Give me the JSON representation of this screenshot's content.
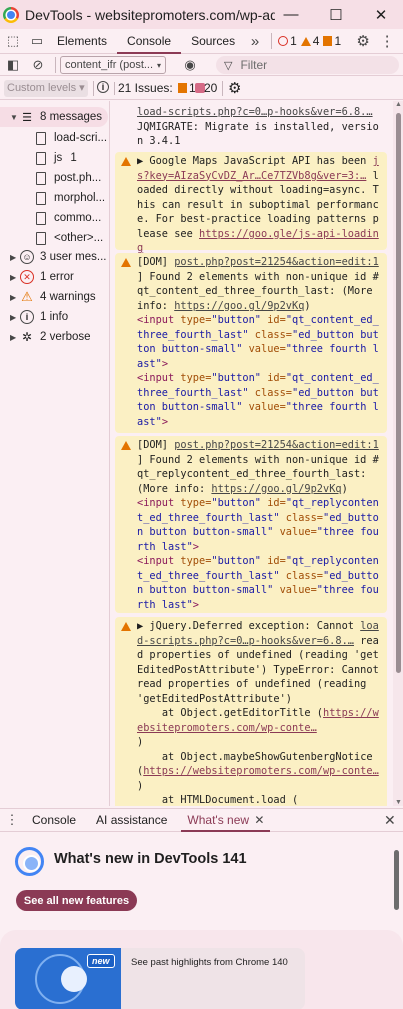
{
  "window": {
    "title": "DevTools - websitepromoters.com/wp-admi...",
    "minimize": "—",
    "maximize": "☐",
    "close": "✕"
  },
  "toolbar": {
    "tabs": [
      "Elements",
      "Console",
      "Sources"
    ],
    "active_tab": "Console",
    "more_tabs": "»",
    "counts": {
      "errors": "1",
      "warnings": "4",
      "issues": "1"
    }
  },
  "console_toolbar": {
    "context": "content_ifr (post...",
    "filter_placeholder": "Filter"
  },
  "console_toolbar2": {
    "levels": "Custom levels ▾",
    "issues_label": "21 Issues:",
    "issues_warn": "1",
    "issues_info": "20"
  },
  "sidebar": {
    "messages": "8 messages",
    "files": [
      "load-scri...",
      "js",
      "post.ph...",
      "morphol...",
      "commo...",
      "<other>..."
    ],
    "files_counts": [
      "",
      "1",
      "",
      "",
      "",
      ""
    ],
    "user_messages": "3 user mes...",
    "errors": "1 error",
    "warnings": "4 warnings",
    "info": "1 info",
    "verbose": "2 verbose"
  },
  "messages": {
    "m1_link": "load-scripts.php?c=0…p-hooks&ver=6.8.…",
    "m1_text": "JQMIGRATE: Migrate is installed, version 3.4.1",
    "m2_head": "▶ Google Maps JavaScript API has been",
    "m2_link": "js?key=AIzaSyCvDZ_Ar…Ce7TZVb8g&ver=3:…",
    "m2_text": "loaded directly without loading=async. This can result in suboptimal performance. For best-practice loading patterns please see",
    "m2_url": "https://goo.gle/js-api-loading",
    "m3_pre": "[DOM] ",
    "m3_link": "post.php?post=21254&action=edit:1",
    "m3_text": "] Found 2 elements with non-unique id #qt_content_ed_three_fourth_last: (More info: ",
    "m3_url": "https://goo.gl/9p2vKq",
    "m3_close": ")",
    "m3_el1_id": "\"qt_content_ed_three_fourth_last\"",
    "m3_el1_class": "\"ed_button button button-small\"",
    "m3_el1_value": "\"three fourth last\"",
    "m4_pre": "[DOM] ",
    "m4_link": "post.php?post=21254&action=edit:1",
    "m4_text": "] Found 2 elements with non-unique id #qt_replycontent_ed_three_fourth_last: (More info: ",
    "m4_url": "https://goo.gl/9p2vKq",
    "m4_close": ")",
    "m4_el_id": "\"qt_replycontent_ed_three_fourth_last\"",
    "m4_el_class": "\"ed_button button button-small\"",
    "m4_el_value": "\"three fourth last\"",
    "m5_head": "▶ jQuery.Deferred exception: Cannot",
    "m5_link": "load-scripts.php?c=0…p-hooks&ver=6.8.…",
    "m5_text": "read properties of undefined (reading 'getEditedPostAttribute') TypeError: Cannot read properties of undefined (reading 'getEditedPostAttribute')",
    "m5_at1": "    at Object.getEditorTitle (",
    "m5_url1": "https://websitepromoters.com/wp-conte…",
    "m5_at2": "    at Object.maybeShowGutenbergNotice (",
    "m5_url2": "https://websitepromoters.com/wp-conte…",
    "m5_at3": "    at HTMLDocument.load (",
    "paren_close": ")"
  },
  "html_tokens": {
    "open": "<input",
    "type_attr": "type=",
    "type_val": "\"button\"",
    "id_attr": "id=",
    "class_attr": "class=",
    "value_attr": "value=",
    "close": ">"
  },
  "drawer": {
    "tabs": [
      "Console",
      "AI assistance",
      "What's new"
    ],
    "active_tab": "What's new",
    "title": "What's new in DevTools 141",
    "button": "See all new features",
    "promo_badge": "new",
    "promo_text": "See past highlights from Chrome 140"
  }
}
